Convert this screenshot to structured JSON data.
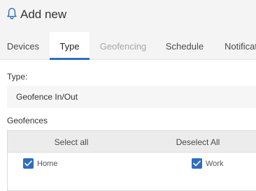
{
  "header": {
    "title": "Add new",
    "icon": "bell-icon"
  },
  "tabs": [
    {
      "label": "Devices",
      "state": "normal"
    },
    {
      "label": "Type",
      "state": "active"
    },
    {
      "label": "Geofencing",
      "state": "disabled"
    },
    {
      "label": "Schedule",
      "state": "normal"
    },
    {
      "label": "Notifications",
      "state": "normal"
    }
  ],
  "form": {
    "type_label": "Type:",
    "type_value": "Geofence In/Out",
    "geofences_label": "Geofences",
    "select_all": "Select all",
    "deselect_all": "Deselect All",
    "items": [
      {
        "label": "Home",
        "checked": true
      },
      {
        "label": "Work",
        "checked": true
      }
    ]
  },
  "colors": {
    "accent": "#2d6ec0",
    "header_bg": "#f4f4f4",
    "disabled_text": "#a6a6a6"
  }
}
